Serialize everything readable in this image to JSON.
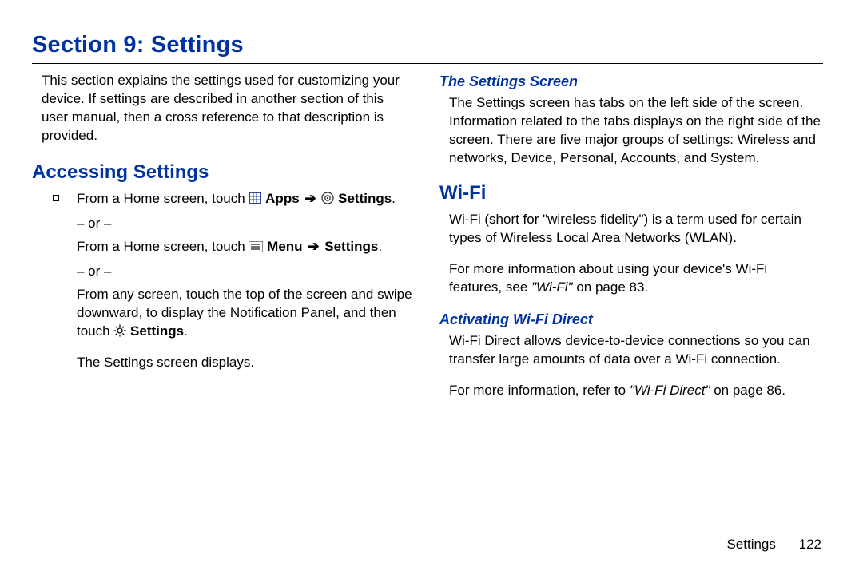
{
  "title": "Section 9: Settings",
  "intro": "This section explains the settings used for customizing your device. If settings are described in another section of this user manual, then a cross reference to that description is provided.",
  "left": {
    "heading": "Accessing Settings",
    "line1a": "From a Home screen, touch ",
    "apps": "Apps",
    "settings": "Settings",
    "dot": ".",
    "or": "– or –",
    "line2a": "From a Home screen, touch ",
    "menu": "Menu",
    "settingsPlain": "Settings",
    "line3": "From any screen, touch the top of the screen and swipe downward, to display the Notification Panel, and then touch ",
    "settings2": "Settings",
    "line4": "The Settings screen displays."
  },
  "right": {
    "sub1": "The Settings Screen",
    "sub1text": "The Settings screen has tabs on the left side of the screen. Information related to the tabs displays on the right side of the screen. There are five major groups of settings: Wireless and networks, Device, Personal, Accounts, and System.",
    "h2": "Wi-Fi",
    "wifi1": "Wi-Fi (short for \"wireless fidelity\") is a term used for certain types of Wireless Local Area Networks (WLAN).",
    "wifi2a": "For more information about using your device's Wi-Fi features, see ",
    "wifi2b": "\"Wi-Fi\"",
    "wifi2c": " on page 83.",
    "sub2": "Activating Wi-Fi Direct",
    "sub2text": "Wi-Fi Direct allows device-to-device connections so you can transfer large amounts of data over a Wi-Fi connection.",
    "sub2b_a": "For more information, refer to ",
    "sub2b_b": "\"Wi-Fi Direct\"",
    "sub2b_c": " on page 86."
  },
  "footer": {
    "label": "Settings",
    "page": "122"
  }
}
